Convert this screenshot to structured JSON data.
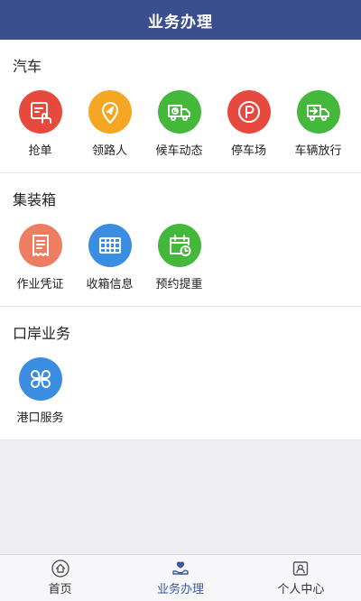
{
  "header": {
    "title": "业务办理"
  },
  "sections": [
    {
      "title": "汽车",
      "items": [
        {
          "label": "抢单",
          "icon": "grab-order-icon",
          "color": "#e8493f"
        },
        {
          "label": "领路人",
          "icon": "location-pin-icon",
          "color": "#f5a623"
        },
        {
          "label": "候车动态",
          "icon": "truck-clock-icon",
          "color": "#44b83a"
        },
        {
          "label": "停车场",
          "icon": "parking-icon",
          "color": "#e8493f"
        },
        {
          "label": "车辆放行",
          "icon": "truck-release-icon",
          "color": "#44b83a"
        }
      ]
    },
    {
      "title": "集装箱",
      "items": [
        {
          "label": "作业凭证",
          "icon": "receipt-icon",
          "color": "#ef7d62"
        },
        {
          "label": "收箱信息",
          "icon": "container-icon",
          "color": "#3a8de0"
        },
        {
          "label": "预约提重",
          "icon": "calendar-clock-icon",
          "color": "#44b83a"
        }
      ]
    },
    {
      "title": "口岸业务",
      "items": [
        {
          "label": "港口服务",
          "icon": "four-leaf-icon",
          "color": "#3a8de0"
        }
      ]
    }
  ],
  "tabs": [
    {
      "label": "首页",
      "icon": "home-icon",
      "active": false
    },
    {
      "label": "业务办理",
      "icon": "hand-heart-icon",
      "active": true
    },
    {
      "label": "个人中心",
      "icon": "user-card-icon",
      "active": false
    }
  ]
}
